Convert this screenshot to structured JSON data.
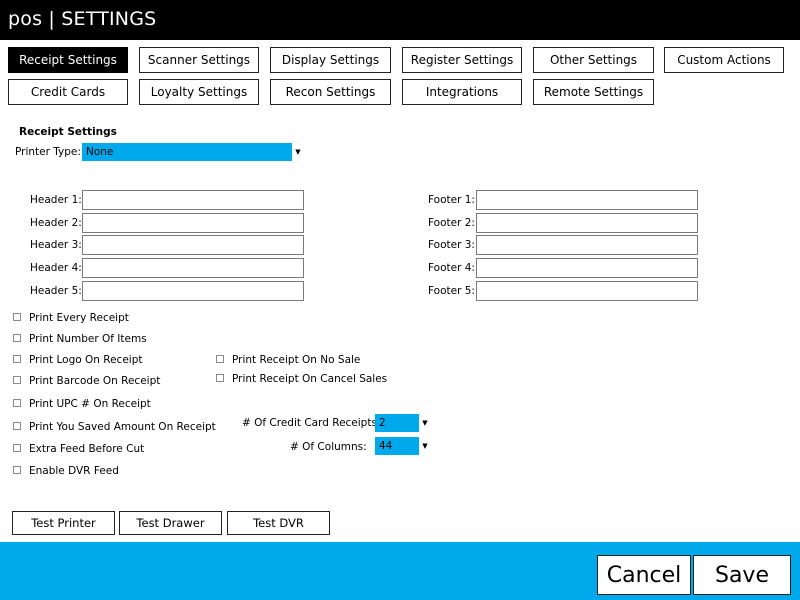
{
  "window": {
    "title": "pos | SETTINGS"
  },
  "tabs": [
    "Receipt Settings",
    "Scanner Settings",
    "Display Settings",
    "Register Settings",
    "Other Settings",
    "Custom Actions",
    "Credit Cards",
    "Loyalty Settings",
    "Recon Settings",
    "Integrations",
    "Remote Settings"
  ],
  "active_tab": "Receipt Settings",
  "section": {
    "title": "Receipt Settings"
  },
  "printer_type": {
    "label": "Printer Type:",
    "value": "None"
  },
  "headers": {
    "labels": [
      "Header 1:",
      "Header 2:",
      "Header 3:",
      "Header 4:",
      "Header 5:"
    ],
    "values": [
      "",
      "",
      "",
      "",
      ""
    ]
  },
  "footers": {
    "labels": [
      "Footer 1:",
      "Footer 2:",
      "Footer 3:",
      "Footer 4:",
      "Footer 5:"
    ],
    "values": [
      "",
      "",
      "",
      "",
      ""
    ]
  },
  "options_left": [
    {
      "label": "Print Every Receipt",
      "checked": false
    },
    {
      "label": "Print Number Of Items",
      "checked": false
    },
    {
      "label": "Print Logo On Receipt",
      "checked": false
    },
    {
      "label": "Print Barcode On Receipt",
      "checked": false
    },
    {
      "label": "Print UPC # On Receipt",
      "checked": false
    },
    {
      "label": "Print You Saved Amount On Receipt",
      "checked": false
    },
    {
      "label": "Extra Feed Before Cut",
      "checked": false
    },
    {
      "label": "Enable DVR Feed",
      "checked": false
    }
  ],
  "options_right": [
    {
      "label": "Print Receipt On No Sale",
      "checked": false
    },
    {
      "label": "Print Receipt On Cancel Sales",
      "checked": false
    }
  ],
  "credit_card_receipts": {
    "label": "# Of Credit Card Receipts:",
    "value": "2"
  },
  "columns": {
    "label": "# Of Columns:",
    "value": "44"
  },
  "test_buttons": [
    "Test Printer",
    "Test Drawer",
    "Test DVR"
  ],
  "actions": {
    "cancel": "Cancel",
    "save": "Save"
  },
  "colors": {
    "accent": "#00a8ec",
    "titlebar": "#000000"
  },
  "icons": {
    "dropdown": "chevron-down-icon",
    "checkbox": "checkbox-icon"
  }
}
